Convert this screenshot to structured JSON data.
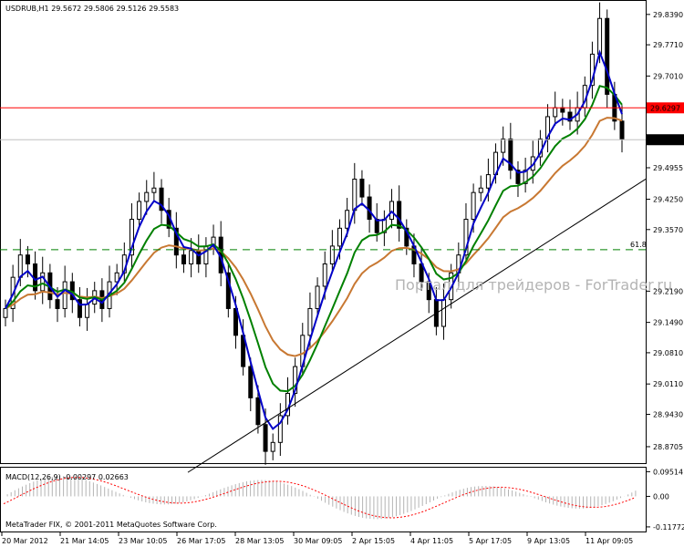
{
  "chart_data": [
    {
      "type": "candlestick",
      "symbol_header": "USDRUB,H1  29.5672 29.5806 29.5126 29.5583",
      "x_tick_labels": [
        "20 Mar 2012",
        "21 Mar 14:05",
        "23 Mar 10:05",
        "26 Mar 17:05",
        "28 Mar 13:05",
        "30 Mar 09:05",
        "2 Apr 15:05",
        "4 Apr 11:05",
        "5 Apr 17:05",
        "9 Apr 13:05",
        "11 Apr 09:05"
      ],
      "y_tick_labels": [
        "29.8390",
        "29.7710",
        "29.7010",
        "29.4955",
        "29.4250",
        "29.3570",
        "29.2190",
        "29.1490",
        "29.0810",
        "29.0110",
        "28.9430",
        "28.8705"
      ],
      "ylim": [
        28.85,
        29.855
      ],
      "current_price": 29.5583,
      "current_price_label": "29.5583",
      "resistance_level": 29.6297,
      "resistance_label": "29.6297",
      "fib_level_value": 29.312,
      "fib_label": "61.8",
      "trendline": {
        "from": [
          "26 Mar 17:05",
          28.813
        ],
        "to": [
          "11 Apr 09:05",
          29.47
        ]
      },
      "watermark": "Портал для трейдеров - ForTrader.ru",
      "closes": [
        29.18,
        29.25,
        29.3,
        29.28,
        29.22,
        29.26,
        29.2,
        29.18,
        29.24,
        29.2,
        29.16,
        29.19,
        29.22,
        29.18,
        29.24,
        29.26,
        29.3,
        29.38,
        29.42,
        29.44,
        29.45,
        29.4,
        29.36,
        29.3,
        29.28,
        29.31,
        29.28,
        29.32,
        29.34,
        29.26,
        29.18,
        29.12,
        29.05,
        28.98,
        28.92,
        28.86,
        28.88,
        28.94,
        28.99,
        29.05,
        29.12,
        29.18,
        29.23,
        29.28,
        29.32,
        29.36,
        29.4,
        29.47,
        29.43,
        29.38,
        29.35,
        29.38,
        29.42,
        29.36,
        29.32,
        29.28,
        29.24,
        29.2,
        29.14,
        29.2,
        29.26,
        29.3,
        29.38,
        29.44,
        29.45,
        29.48,
        29.53,
        29.56,
        29.49,
        29.46,
        29.49,
        29.52,
        29.56,
        29.61,
        29.63,
        29.62,
        29.6,
        29.63,
        29.68,
        29.75,
        29.83,
        29.66,
        29.6,
        29.56
      ]
    },
    {
      "type": "histogram",
      "indicator_label": "MACD(12,26,9) -0.00297 0.02663",
      "y_tick_labels": [
        "0.09514",
        "0.00",
        "-0.11772"
      ],
      "ylim": [
        -0.125,
        0.1
      ]
    }
  ],
  "footer": {
    "copyright": "MetaTrader FIX, © 2001-2011 MetaQuotes Software Corp."
  },
  "colors": {
    "candle": "#000000",
    "ma_fast": "#0000c8",
    "ma_mid": "#008000",
    "ma_slow": "#c87832",
    "resistance": "#ff0000",
    "fib": "#008000",
    "macd_hist": "#b4b4b4",
    "macd_signal": "#ff0000",
    "watermark": "#b4b4b4"
  }
}
